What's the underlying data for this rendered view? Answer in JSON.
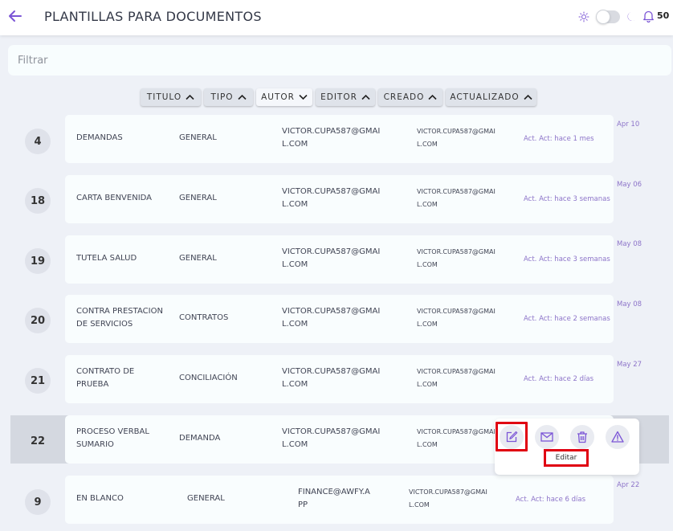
{
  "header": {
    "title": "PLANTILLAS PARA DOCUMENTOS",
    "notification_count": "50",
    "theme_toggle_on": false,
    "accent": "#7b55d6"
  },
  "filter": {
    "placeholder": "Filtrar",
    "value": ""
  },
  "sort_columns": [
    {
      "label": "TITULO",
      "direction": "up"
    },
    {
      "label": "TIPO",
      "direction": "up"
    },
    {
      "label": "AUTOR",
      "direction": "down",
      "active": true
    },
    {
      "label": "EDITOR",
      "direction": "up"
    },
    {
      "label": "CREADO",
      "direction": "up"
    },
    {
      "label": "ACTUALIZADO",
      "direction": "up"
    }
  ],
  "rows": [
    {
      "id": "4",
      "title": "DEMANDAS",
      "type": "GENERAL",
      "author": [
        "VICTOR.CUPA587@GMAI",
        "L.COM"
      ],
      "editor": [
        "VICTOR.CUPA587@GMAI",
        "L.COM"
      ],
      "updated": "Act. Act: hace 1 mes",
      "created": "Apr 10"
    },
    {
      "id": "18",
      "title": "CARTA BENVENIDA",
      "type": "GENERAL",
      "author": [
        "VICTOR.CUPA587@GMAI",
        "L.COM"
      ],
      "editor": [
        "VICTOR.CUPA587@GMAI",
        "L.COM"
      ],
      "updated": "Act. Act: hace 3 semanas",
      "created": "May 06"
    },
    {
      "id": "19",
      "title": "TUTELA SALUD",
      "type": "GENERAL",
      "author": [
        "VICTOR.CUPA587@GMAI",
        "L.COM"
      ],
      "editor": [
        "VICTOR.CUPA587@GMAI",
        "L.COM"
      ],
      "updated": "Act. Act: hace 3 semanas",
      "created": "May 08"
    },
    {
      "id": "20",
      "title": [
        "CONTRA PRESTACION",
        "DE SERVICIOS"
      ],
      "type": "CONTRATOS",
      "author": [
        "VICTOR.CUPA587@GMAI",
        "L.COM"
      ],
      "editor": [
        "VICTOR.CUPA587@GMAI",
        "L.COM"
      ],
      "updated": "Act. Act: hace 2 semanas",
      "created": "May 08"
    },
    {
      "id": "21",
      "title": [
        "CONTRATO DE",
        "PRUEBA"
      ],
      "type": "CONCILIACIÓN",
      "author": [
        "VICTOR.CUPA587@GMAI",
        "L.COM"
      ],
      "editor": [
        "VICTOR.CUPA587@GMAI",
        "L.COM"
      ],
      "updated": "Act. Act: hace 2 días",
      "created": "May 27"
    },
    {
      "id": "22",
      "title": [
        "PROCESO VERBAL",
        "SUMARIO"
      ],
      "type": "DEMANDA",
      "author": [
        "VICTOR.CUPA587@GMAI",
        "L.COM"
      ],
      "editor": [
        "VICTOR.CUPA587@GMAI",
        "L.COM"
      ],
      "updated": "",
      "created": ""
    },
    {
      "id": "9",
      "title": "EN BLANCO",
      "type": "GENERAL",
      "author": [
        "FINANCE@AWFY.A",
        "PP"
      ],
      "editor": [
        "VICTOR.CUPA587@GMAI",
        "L.COM"
      ],
      "updated": "Act. Act: hace 6 días",
      "created": "Apr 22"
    }
  ],
  "row_actions": {
    "edit_tooltip": "Editar",
    "icons": [
      "edit-icon",
      "mail-icon",
      "trash-icon",
      "warning-icon"
    ]
  }
}
